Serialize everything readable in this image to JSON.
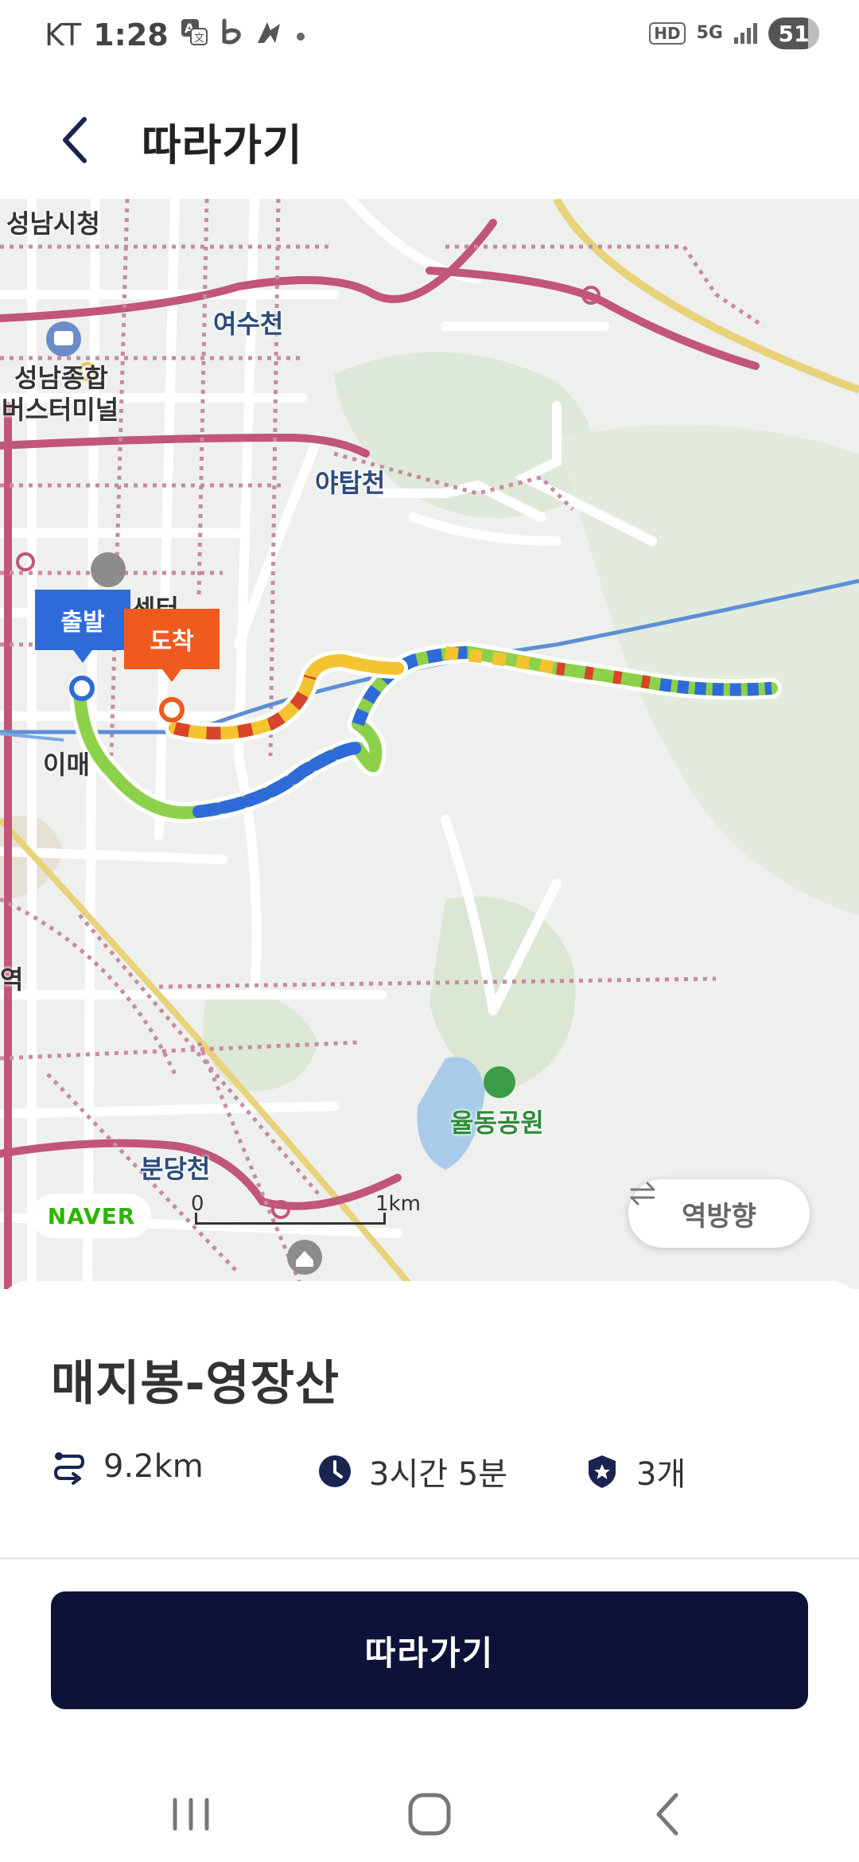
{
  "status_bar": {
    "carrier": "KT",
    "time": "1:28",
    "left_icons": [
      "translate-icon",
      "b-app-icon",
      "flag-app-icon",
      "dot-icon"
    ],
    "hd_badge": "HD",
    "network": "5G",
    "battery": "51"
  },
  "header": {
    "back_icon": "chevron-left-icon",
    "title": "따라가기"
  },
  "map": {
    "labels": {
      "seongnam_cityhall": "성남시청",
      "bus_terminal_1": "성남종합",
      "bus_terminal_2": "버스터미널",
      "yeosucheon": "여수천",
      "yatapcheon": "야탑천",
      "center": "센터",
      "imae": "이매",
      "station": "역",
      "yuldong_park": "율동공원",
      "bundangcheon": "분당천"
    },
    "start_pin": "출발",
    "end_pin": "도착",
    "naver_logo": "NAVER",
    "scale_start": "0",
    "scale_end": "1km",
    "reverse_button": "역방향",
    "reverse_icon": "swap-arrows-icon",
    "colors": {
      "start": "#2f6bd8",
      "end": "#ef5a1f",
      "road_main": "#c2557a",
      "stream": "#3d7fd6"
    }
  },
  "trail": {
    "name": "매지봉-영장산",
    "distance": "9.2km",
    "distance_icon": "route-icon",
    "duration": "3시간 5분",
    "duration_icon": "clock-icon",
    "certifications": "3개",
    "certification_icon": "badge-star-icon"
  },
  "follow_button": "따라가기",
  "nav_bar": {
    "recents_icon": "recents-icon",
    "home_icon": "home-icon",
    "back_icon": "back-icon"
  }
}
